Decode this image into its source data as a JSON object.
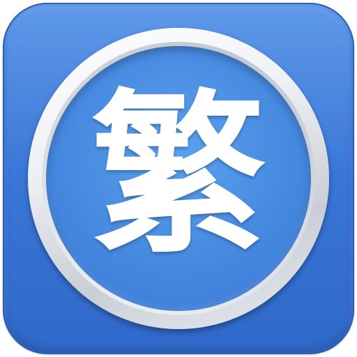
{
  "app_icon": {
    "glyph": "繁",
    "colors": {
      "tile": "#3b78d8",
      "tile_border": "#2a5db5",
      "ring": "#eef1f5",
      "disc": "#4689e0",
      "glyph": "#ffffff"
    }
  }
}
